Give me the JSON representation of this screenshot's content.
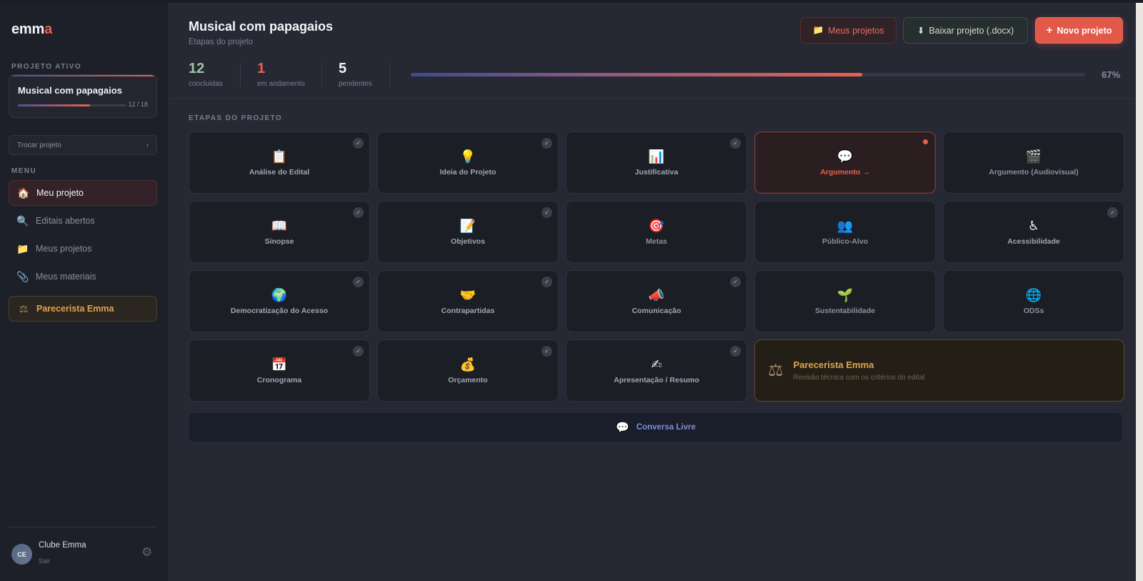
{
  "brand": {
    "logo_main": "emm",
    "logo_accent": "a",
    "accent_color": "#e8614c"
  },
  "sidebar": {
    "active_project_label": "PROJETO ATIVO",
    "active_project": {
      "name": "Musical com papagaios",
      "progress_text": "12 / 18",
      "progress_fraction": 0.667
    },
    "switch_project": {
      "label": "Trocar projeto",
      "chevron": "›"
    },
    "menu_label": "MENU",
    "menu_items": [
      {
        "icon": "🏠",
        "icon_name": "home-icon",
        "label": "Meu projeto",
        "active": true
      },
      {
        "icon": "🔍",
        "icon_name": "search-icon",
        "label": "Editais abertos"
      },
      {
        "icon": "📁",
        "icon_name": "folder-icon",
        "label": "Meus projetos"
      },
      {
        "icon": "📎",
        "icon_name": "paperclip-icon",
        "label": "Meus materiais"
      }
    ],
    "reviewer": {
      "icon": "⚖",
      "icon_name": "scale-icon",
      "label": "Parecerista Emma"
    },
    "user": {
      "initials": "CE",
      "name": "Clube Emma",
      "logout": "Sair",
      "gear": "⚙"
    }
  },
  "header": {
    "title": "Musical com papagaios",
    "subtitle": "Etapas do projeto",
    "buttons": {
      "projects": {
        "icon": "📁",
        "label": "Meus projetos"
      },
      "download": {
        "icon": "⬇",
        "label": "Baixar projeto (.docx)"
      },
      "new_project": {
        "icon": "+",
        "label": "Novo projeto"
      }
    },
    "stats": [
      {
        "value": "12",
        "label": "concluídas",
        "color": "#9bc7a6"
      },
      {
        "value": "1",
        "label": "em andamento",
        "color": "#e8614c"
      },
      {
        "value": "5",
        "label": "pendentes",
        "color": "#f4f5f8"
      }
    ],
    "progress": {
      "fraction": 0.67,
      "text": "67%"
    }
  },
  "main": {
    "section_label": "ETAPAS DO PROJETO",
    "steps": [
      {
        "icon": "📋",
        "label": "Análise do Edital",
        "status": "done"
      },
      {
        "icon": "💡",
        "label": "Ideia do Projeto",
        "status": "done"
      },
      {
        "icon": "📊",
        "label": "Justificativa",
        "status": "done"
      },
      {
        "icon": "💬",
        "label": "Argumento →",
        "status": "current"
      },
      {
        "icon": "🎬",
        "label": "Argumento (Audiovisual)",
        "status": "pending"
      },
      {
        "icon": "📖",
        "label": "Sinopse",
        "status": "done"
      },
      {
        "icon": "📝",
        "label": "Objetivos",
        "status": "done"
      },
      {
        "icon": "🎯",
        "label": "Metas",
        "status": "pending"
      },
      {
        "icon": "👥",
        "label": "Público-Alvo",
        "status": "pending"
      },
      {
        "icon": "♿",
        "label": "Acessibilidade",
        "status": "done"
      },
      {
        "icon": "🌍",
        "label": "Democratização do Acesso",
        "status": "done"
      },
      {
        "icon": "🤝",
        "label": "Contrapartidas",
        "status": "done"
      },
      {
        "icon": "📣",
        "label": "Comunicação",
        "status": "done"
      },
      {
        "icon": "🌱",
        "label": "Sustentabilidade",
        "status": "pending"
      },
      {
        "icon": "🌐",
        "label": "ODSs",
        "status": "pending"
      },
      {
        "icon": "📅",
        "label": "Cronograma",
        "status": "done"
      },
      {
        "icon": "💰",
        "label": "Orçamento",
        "status": "done"
      },
      {
        "icon": "✍",
        "label": "Apresentação / Resumo",
        "status": "done"
      }
    ],
    "check_glyph": "✓",
    "review_card": {
      "icon": "⚖",
      "title": "Parecerista Emma",
      "subtitle": "Revisão técnica com os critérios do edital"
    },
    "free_chat": {
      "icon": "💬",
      "label": "Conversa Livre"
    }
  }
}
